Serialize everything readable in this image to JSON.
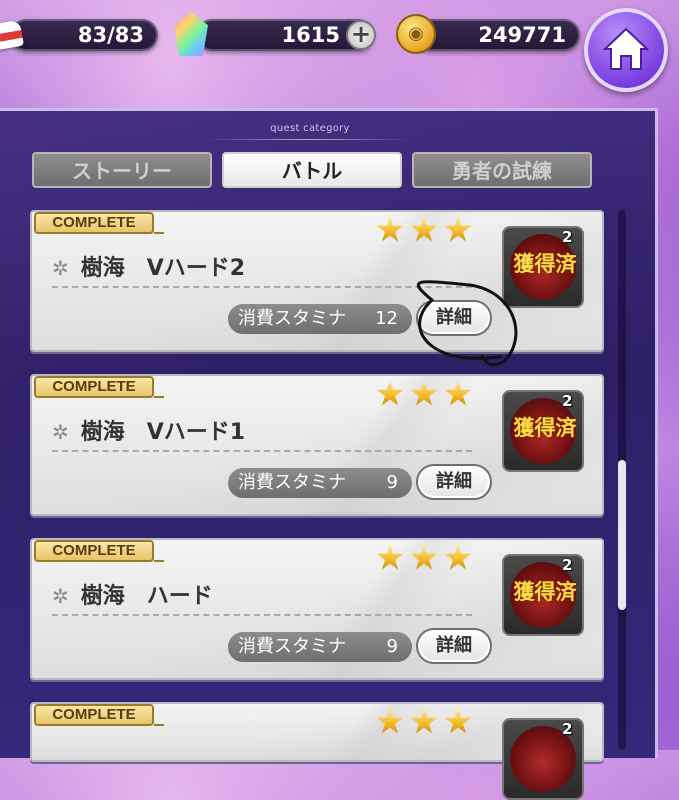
{
  "top_bar": {
    "stamina": "83/83",
    "gems": "1615",
    "coins": "249771",
    "stamina_icon": "shoe-icon",
    "gem_icon": "gem-icon",
    "coin_icon": "coin-icon",
    "plus_icon": "plus-icon",
    "home_icon": "home-icon"
  },
  "panel": {
    "section_label": "quest category",
    "tabs": [
      {
        "label": "ストーリー",
        "active": false
      },
      {
        "label": "バトル",
        "active": true
      },
      {
        "label": "勇者の試練",
        "active": false
      }
    ]
  },
  "quests": [
    {
      "badge": "COMPLETE",
      "stars": 3,
      "mark": "✲",
      "title": "樹海　Vハード2",
      "stamina_label": "消費スタミナ",
      "stamina_cost": "12",
      "detail_label": "詳細",
      "reward_label": "獲得済",
      "reward_count": "2"
    },
    {
      "badge": "COMPLETE",
      "stars": 3,
      "mark": "✲",
      "title": "樹海　Vハード1",
      "stamina_label": "消費スタミナ",
      "stamina_cost": "9",
      "detail_label": "詳細",
      "reward_label": "獲得済",
      "reward_count": "2"
    },
    {
      "badge": "COMPLETE",
      "stars": 3,
      "mark": "✲",
      "title": "樹海　ハード",
      "stamina_label": "消費スタミナ",
      "stamina_cost": "9",
      "detail_label": "詳細",
      "reward_label": "獲得済",
      "reward_count": "2"
    },
    {
      "badge": "COMPLETE",
      "stars": 3,
      "reward_count": "2"
    }
  ],
  "colors": {
    "panel_bg": "#2d1f66",
    "reward_text": "#ffde4a",
    "badge_bg": "#e6c56b",
    "star": "#f0b424"
  }
}
